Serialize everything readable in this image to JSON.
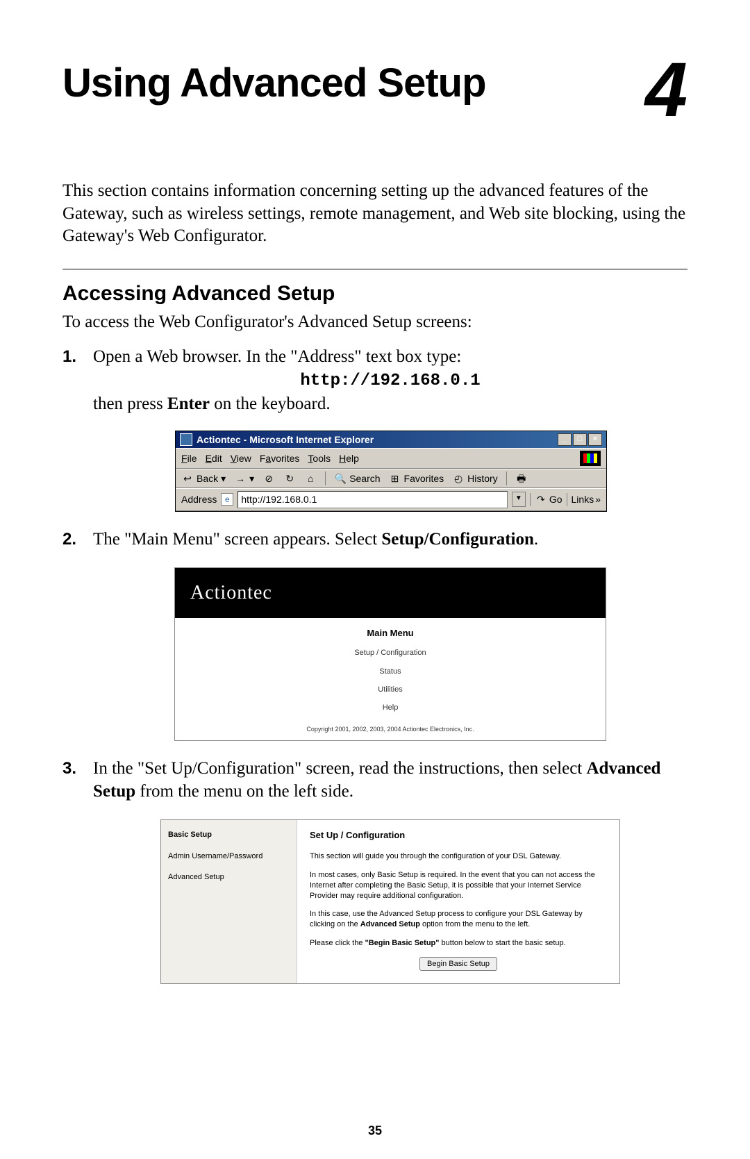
{
  "chapter": {
    "title": "Using Advanced Setup",
    "number": "4"
  },
  "intro": "This section contains information concerning setting up the advanced features of the Gateway, such as wireless settings, remote management, and Web site blocking, using the Gateway's Web Configurator.",
  "section_title": "Accessing Advanced Setup",
  "section_intro": "To access the Web Configurator's Advanced Setup screens:",
  "steps": {
    "s1_a": "Open a Web browser. In the \"Address\" text box type:",
    "s1_url": "http://192.168.0.1",
    "s1_b_pre": "then press ",
    "s1_b_bold": "Enter",
    "s1_b_post": " on the keyboard.",
    "s2_pre": "The \"Main Menu\" screen appears. Select ",
    "s2_bold": "Setup/Configuration",
    "s2_post": ".",
    "s3_a": "In the \"Set Up/Configuration\" screen, read the instructions, then select ",
    "s3_bold": "Advanced Setup",
    "s3_b": " from the menu on the left side."
  },
  "ie": {
    "title": "Actiontec - Microsoft Internet Explorer",
    "menu": {
      "file": "File",
      "edit": "Edit",
      "view": "View",
      "favorites": "Favorites",
      "tools": "Tools",
      "help": "Help"
    },
    "toolbar": {
      "back": "Back",
      "search": "Search",
      "favorites": "Favorites",
      "history": "History"
    },
    "address_label": "Address",
    "address_value": "http://192.168.0.1",
    "go": "Go",
    "links": "Links"
  },
  "mainmenu": {
    "brand": "Actiontec",
    "title": "Main Menu",
    "items": [
      "Setup / Configuration",
      "Status",
      "Utilities",
      "Help"
    ],
    "copyright": "Copyright 2001, 2002, 2003, 2004 Actiontec Electronics, Inc."
  },
  "setup": {
    "side": {
      "basic": "Basic Setup",
      "admin": "Admin Username/Password",
      "advanced": "Advanced Setup"
    },
    "title": "Set Up / Configuration",
    "p1": "This section will guide you through the configuration of your DSL Gateway.",
    "p2": "In most cases, only Basic Setup is required. In the event that you can not access the Internet after completing the Basic Setup, it is possible that your Internet Service Provider may require additional configuration.",
    "p3_a": "In this case, use the Advanced Setup process to configure your DSL Gateway by clicking on the ",
    "p3_bold": "Advanced Setup",
    "p3_b": " option from the menu to the left.",
    "p4_a": "Please click the ",
    "p4_bold": "\"Begin Basic Setup\"",
    "p4_b": " button below to start the basic setup.",
    "button": "Begin Basic Setup"
  },
  "page_number": "35"
}
